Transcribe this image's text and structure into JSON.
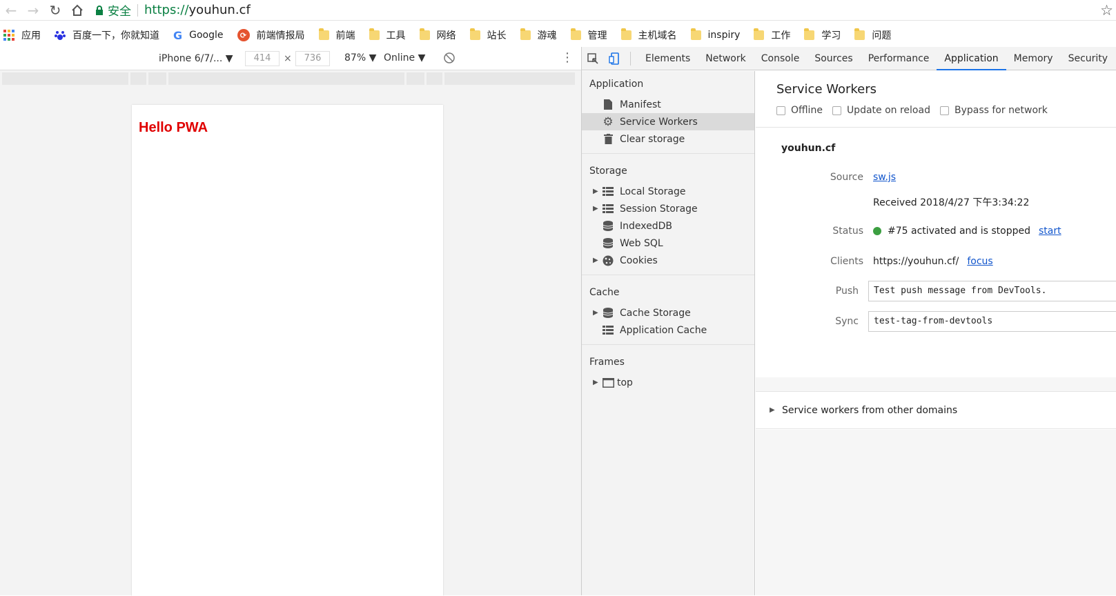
{
  "browser": {
    "secure_label": "安全",
    "url_scheme": "https://",
    "url_host": "youhun.cf"
  },
  "bookmarks": [
    {
      "label": "应用",
      "icon": "apps-grid-icon"
    },
    {
      "label": "百度一下，你就知道",
      "icon": "baidu-paw-icon"
    },
    {
      "label": "Google",
      "icon": "google-g-icon"
    },
    {
      "label": "前端情报局",
      "icon": "red-circle-icon"
    },
    {
      "label": "前端",
      "icon": "folder-icon"
    },
    {
      "label": "工具",
      "icon": "folder-icon"
    },
    {
      "label": "网络",
      "icon": "folder-icon"
    },
    {
      "label": "站长",
      "icon": "folder-icon"
    },
    {
      "label": "游魂",
      "icon": "folder-icon"
    },
    {
      "label": "管理",
      "icon": "folder-icon"
    },
    {
      "label": "主机域名",
      "icon": "folder-icon"
    },
    {
      "label": "inspiry",
      "icon": "folder-icon"
    },
    {
      "label": "工作",
      "icon": "folder-icon"
    },
    {
      "label": "学习",
      "icon": "folder-icon"
    },
    {
      "label": "问题",
      "icon": "folder-icon"
    }
  ],
  "device_toolbar": {
    "device": "iPhone 6/7/...",
    "width": "414",
    "height": "736",
    "times": "×",
    "zoom": "87%",
    "network": "Online"
  },
  "page": {
    "heading": "Hello PWA",
    "heading_color": "#e00000"
  },
  "devtools": {
    "tabs": [
      "Elements",
      "Network",
      "Console",
      "Sources",
      "Performance",
      "Application",
      "Memory",
      "Security"
    ],
    "active_tab": "Application",
    "accent": "#1a73e8",
    "sidebar": {
      "application": {
        "title": "Application",
        "items": [
          "Manifest",
          "Service Workers",
          "Clear storage"
        ]
      },
      "storage": {
        "title": "Storage",
        "items": [
          "Local Storage",
          "Session Storage",
          "IndexedDB",
          "Web SQL",
          "Cookies"
        ]
      },
      "cache": {
        "title": "Cache",
        "items": [
          "Cache Storage",
          "Application Cache"
        ]
      },
      "frames": {
        "title": "Frames",
        "items": [
          "top"
        ]
      }
    },
    "panel": {
      "title": "Service Workers",
      "options": [
        "Offline",
        "Update on reload",
        "Bypass for network"
      ],
      "origin": "youhun.cf",
      "source_label": "Source",
      "source_link": "sw.js",
      "received": "Received 2018/4/27 下午3:34:22",
      "status_label": "Status",
      "status_text": "#75 activated and is stopped",
      "status_link": "start",
      "status_color": "#3c9f41",
      "clients_label": "Clients",
      "clients_value": "https://youhun.cf/",
      "clients_link": "focus",
      "push_label": "Push",
      "push_value": "Test push message from DevTools.",
      "sync_label": "Sync",
      "sync_value": "test-tag-from-devtools",
      "other_domains": "Service workers from other domains"
    }
  }
}
